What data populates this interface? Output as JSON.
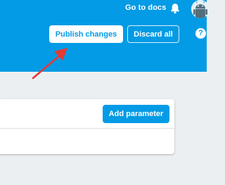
{
  "header": {
    "docs_link": "Go to docs",
    "bell_icon": "bell-icon",
    "avatar_icon": "android-avatar-icon",
    "help_label": "?"
  },
  "actions": {
    "publish_label": "Publish changes",
    "discard_label": "Discard all"
  },
  "parameters_card": {
    "add_label": "Add parameter"
  },
  "colors": {
    "header_bg": "#039be5",
    "page_bg": "#eceff1",
    "arrow": "#e53935"
  }
}
